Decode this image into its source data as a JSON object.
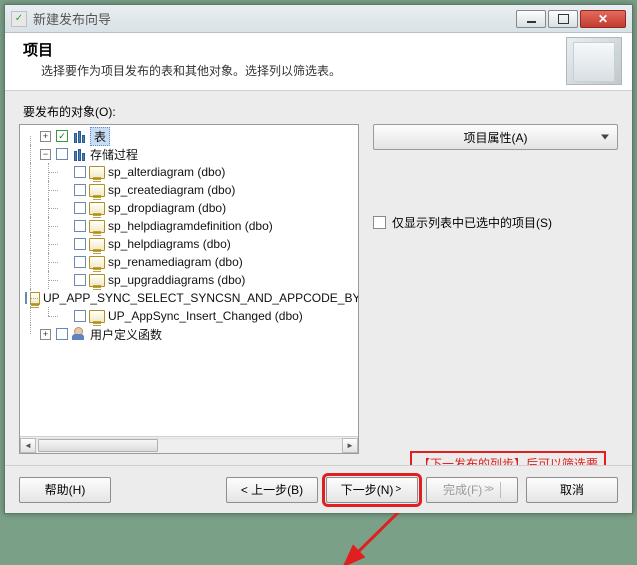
{
  "window": {
    "title": "新建发布向导"
  },
  "header": {
    "heading": "项目",
    "subheading": "选择要作为项目发布的表和其他对象。选择列以筛选表。"
  },
  "objects_label": "要发布的对象(O):",
  "tree": {
    "root_tables": "表",
    "root_procs": "存储过程",
    "root_udf": "用户定义函数",
    "procs": [
      "sp_alterdiagram (dbo)",
      "sp_creatediagram (dbo)",
      "sp_dropdiagram (dbo)",
      "sp_helpdiagramdefinition (dbo)",
      "sp_helpdiagrams (dbo)",
      "sp_renamediagram (dbo)",
      "sp_upgraddiagrams (dbo)",
      "UP_APP_SYNC_SELECT_SYNCSN_AND_APPCODE_BY_",
      "UP_AppSync_Insert_Changed (dbo)"
    ]
  },
  "right": {
    "prop_button": "项目属性(A)",
    "only_selected": "仅显示列表中已选中的项目(S)"
  },
  "tooltip": "【下一发布的列步】后可以筛选要",
  "footer": {
    "help": "帮助(H)",
    "back": "< 上一步(B)",
    "next_prefix": "下一步(N)",
    "finish_prefix": "完成(F)",
    "cancel": "取消"
  }
}
